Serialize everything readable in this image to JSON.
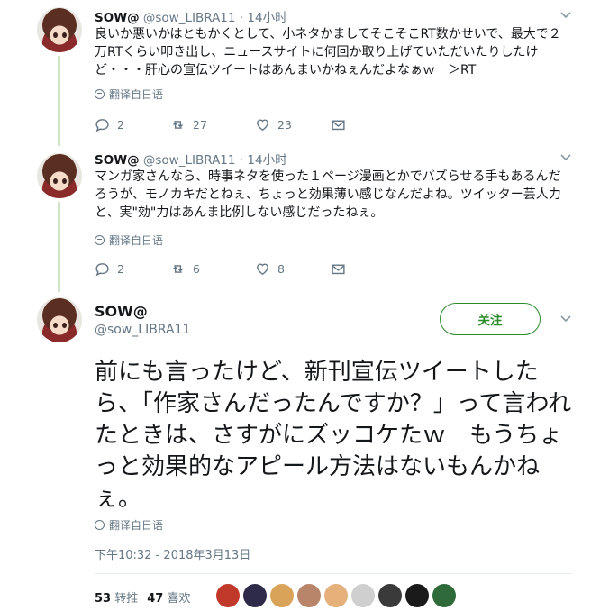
{
  "tweets": [
    {
      "name": "SOW@",
      "handle": "@sow_LIBRA11",
      "dot": "·",
      "time": "14小时",
      "text": "良いか悪いかはともかくとして、小ネタかましてそこそこRT数かせいで、最大で２万RTくらい叩き出し、ニュースサイトに何回か取り上げていただいたりしたけど・・・肝心の宣伝ツイートはあんまいかねぇんだよなぁｗ　＞RT",
      "translate": "翻译自日语",
      "replies": "2",
      "retweets": "27",
      "likes": "23"
    },
    {
      "name": "SOW@",
      "handle": "@sow_LIBRA11",
      "dot": "·",
      "time": "14小时",
      "text": "マンガ家さんなら、時事ネタを使った１ページ漫画とかでバズらせる手もあるんだろうが、モノカキだとねぇ、ちょっと効果薄い感じなんだよね。ツイッター芸人力と、実\"効\"力はあんま比例しない感じだったねぇ。",
      "translate": "翻译自日语",
      "replies": "2",
      "retweets": "6",
      "likes": "8"
    }
  ],
  "main": {
    "name": "SOW@",
    "handle": "@sow_LIBRA11",
    "follow_label": "关注",
    "text": "前にも言ったけど、新刊宣伝ツイートしたら、「作家さんだったんですか？」って言われたときは、さすがにズッコケたｗ　もうちょっと効果的なアピール方法はないもんかねぇ。",
    "translate": "翻译自日语",
    "timestamp": "下午10:32 - 2018年3月13日",
    "retweet_count": "53",
    "retweet_label": "转推",
    "like_count": "47",
    "like_label": "喜欢"
  },
  "colors": {
    "accent_green": "#2a8c2a",
    "thread_line": "#cfe3c6",
    "muted": "#657786"
  },
  "likers": [
    {
      "color": "#c0392b"
    },
    {
      "color": "#2d2a4a"
    },
    {
      "color": "#d9a35a"
    },
    {
      "color": "#b9856a"
    },
    {
      "color": "#e6b07a"
    },
    {
      "color": "#cfcfcf"
    },
    {
      "color": "#3a3a3a"
    },
    {
      "color": "#1a1a1a"
    },
    {
      "color": "#2f6b3a"
    }
  ]
}
